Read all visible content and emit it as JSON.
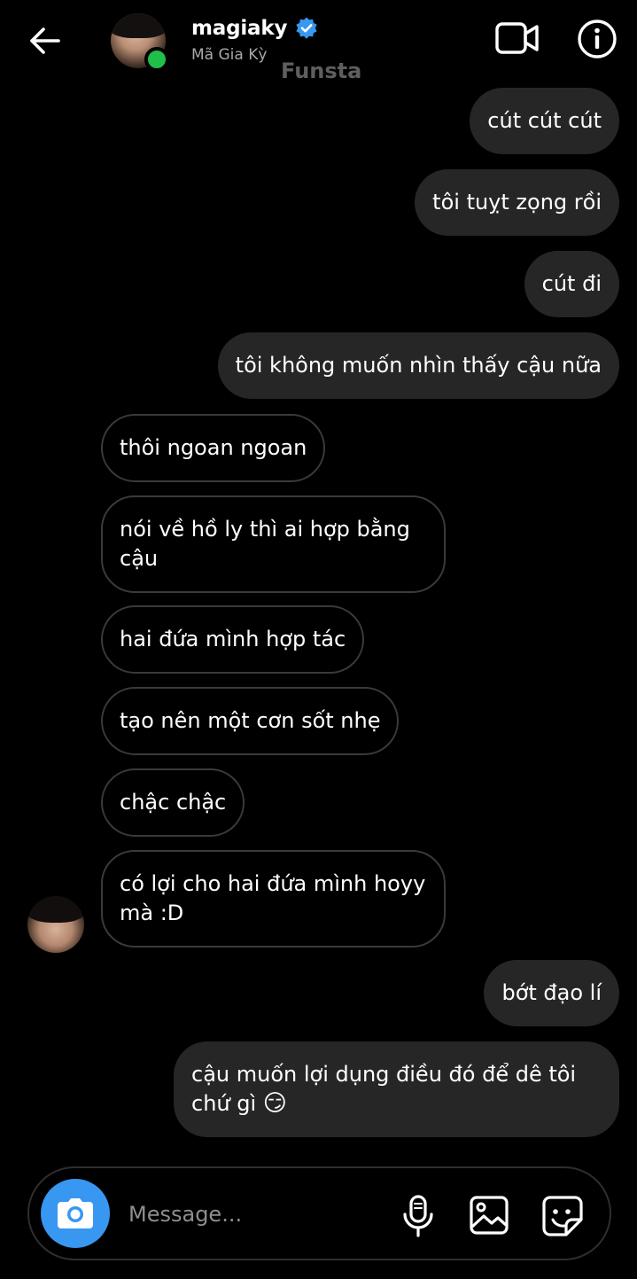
{
  "header": {
    "username": "magiaky",
    "real_name": "Mã Gia Kỳ",
    "watermark": "Funsta"
  },
  "messages": [
    {
      "side": "out",
      "text": "cút cút cút"
    },
    {
      "side": "out",
      "text": "tôi tuỵt zọng rồi"
    },
    {
      "side": "out",
      "text": "cút đi"
    },
    {
      "side": "out",
      "text": "tôi không muốn nhìn thấy cậu nữa"
    },
    {
      "side": "in",
      "text": "thôi ngoan ngoan"
    },
    {
      "side": "in",
      "text": "nói về hồ ly thì ai hợp bằng cậu"
    },
    {
      "side": "in",
      "text": "hai đứa mình hợp tác"
    },
    {
      "side": "in",
      "text": "tạo nên một cơn sốt nhẹ"
    },
    {
      "side": "in",
      "text": "chậc chậc"
    },
    {
      "side": "in",
      "text": "có lợi cho hai đứa mình hoyy mà :D"
    },
    {
      "side": "out",
      "text": "bớt đạo lí"
    },
    {
      "side": "out",
      "text": "cậu muốn lợi dụng điều đó để dê tôi chứ gì",
      "emoji": "😏"
    }
  ],
  "composer": {
    "placeholder": "Message..."
  },
  "icons": {
    "back": "arrow-left-icon",
    "verified": "verified-badge-icon",
    "video": "video-call-icon",
    "info": "info-icon",
    "camera": "camera-icon",
    "mic": "microphone-icon",
    "gallery": "image-gallery-icon",
    "sticker": "sticker-icon"
  },
  "colors": {
    "background": "#000000",
    "outgoing_bubble": "#262626",
    "incoming_border": "#3a3a3a",
    "accent_blue": "#3897f0",
    "online_green": "#1fbf4a"
  }
}
